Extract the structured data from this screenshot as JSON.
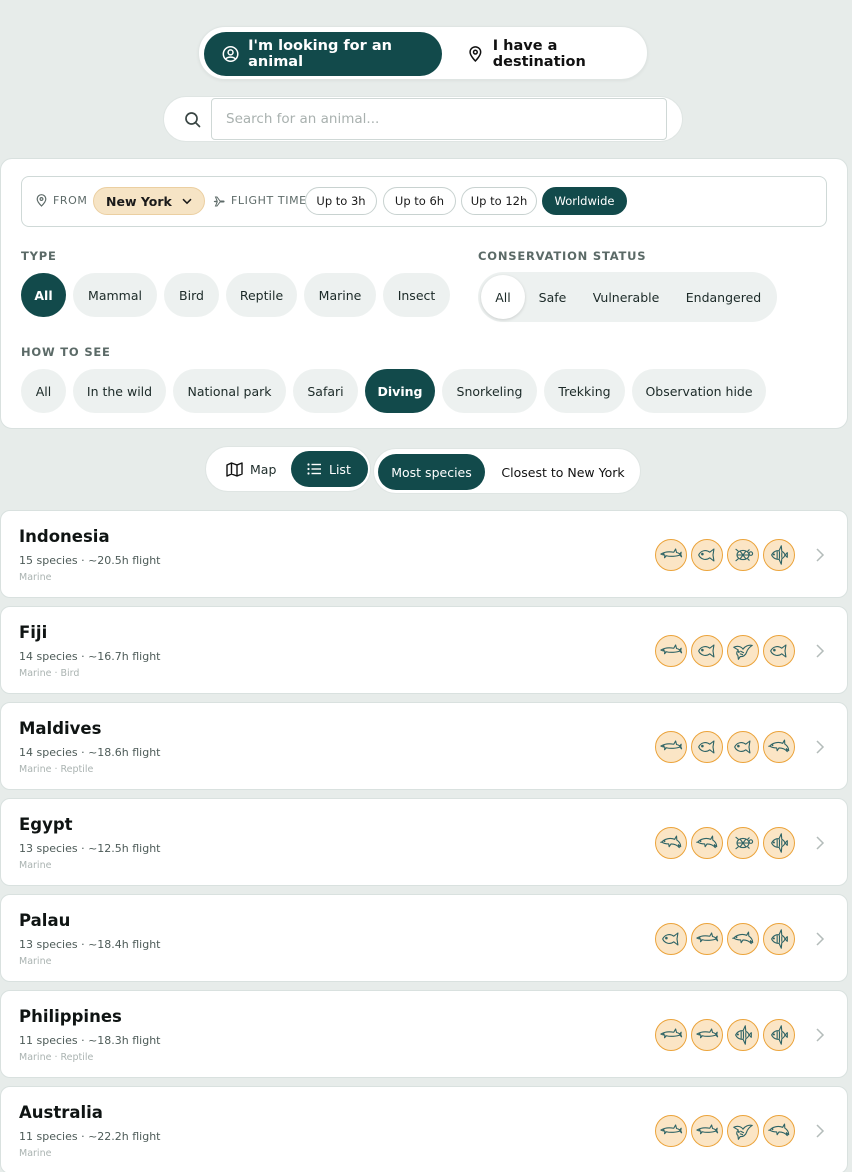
{
  "mode_toggle": {
    "active_label": "I'm looking for an animal",
    "inactive_label": "I have a destination"
  },
  "search": {
    "placeholder": "Search for an animal..."
  },
  "filters": {
    "from_label": "FROM",
    "from_city": "New York",
    "flight_time_label": "FLIGHT TIME",
    "flight_options": [
      {
        "label": "Up to 3h",
        "active": false
      },
      {
        "label": "Up to 6h",
        "active": false
      },
      {
        "label": "Up to 12h",
        "active": false
      },
      {
        "label": "Worldwide",
        "active": true
      }
    ],
    "type_label": "TYPE",
    "types": [
      {
        "label": "All",
        "active": true
      },
      {
        "label": "Mammal",
        "active": false
      },
      {
        "label": "Bird",
        "active": false
      },
      {
        "label": "Reptile",
        "active": false
      },
      {
        "label": "Marine",
        "active": false
      },
      {
        "label": "Insect",
        "active": false
      }
    ],
    "conservation_label": "CONSERVATION STATUS",
    "conservation": [
      {
        "label": "All",
        "active": true
      },
      {
        "label": "Safe",
        "active": false
      },
      {
        "label": "Vulnerable",
        "active": false
      },
      {
        "label": "Endangered",
        "active": false
      }
    ],
    "how_label": "HOW TO SEE",
    "how": [
      {
        "label": "All",
        "active": false
      },
      {
        "label": "In the wild",
        "active": false
      },
      {
        "label": "National park",
        "active": false
      },
      {
        "label": "Safari",
        "active": false
      },
      {
        "label": "Diving",
        "active": true
      },
      {
        "label": "Snorkeling",
        "active": false
      },
      {
        "label": "Trekking",
        "active": false
      },
      {
        "label": "Observation hide",
        "active": false
      }
    ]
  },
  "view": {
    "map_label": "Map",
    "list_label": "List",
    "active": "list"
  },
  "sort": {
    "most_label": "Most species",
    "closest_label": "Closest to New York",
    "active": "most"
  },
  "destinations": [
    {
      "name": "Indonesia",
      "meta": "15 species · ~20.5h flight",
      "tags": "Marine",
      "icons": [
        "shark-icon",
        "fish-icon",
        "turtle-icon",
        "angelfish-icon"
      ]
    },
    {
      "name": "Fiji",
      "meta": "14 species · ~16.7h flight",
      "tags": "Marine · Bird",
      "icons": [
        "shark-icon",
        "fish-icon",
        "bird-icon",
        "fish-icon"
      ]
    },
    {
      "name": "Maldives",
      "meta": "14 species · ~18.6h flight",
      "tags": "Marine · Reptile",
      "icons": [
        "shark-icon",
        "fish-icon",
        "fish-icon",
        "dolphin-icon"
      ]
    },
    {
      "name": "Egypt",
      "meta": "13 species · ~12.5h flight",
      "tags": "Marine",
      "icons": [
        "dolphin-icon",
        "dolphin-icon",
        "turtle-icon",
        "angelfish-icon"
      ]
    },
    {
      "name": "Palau",
      "meta": "13 species · ~18.4h flight",
      "tags": "Marine",
      "icons": [
        "fish-icon",
        "shark-icon",
        "dolphin-icon",
        "angelfish-icon"
      ]
    },
    {
      "name": "Philippines",
      "meta": "11 species · ~18.3h flight",
      "tags": "Marine · Reptile",
      "icons": [
        "shark-icon",
        "shark-icon",
        "angelfish-icon",
        "angelfish-icon"
      ]
    },
    {
      "name": "Australia",
      "meta": "11 species · ~22.2h flight",
      "tags": "Marine",
      "icons": [
        "shark-icon",
        "shark-icon",
        "bird-icon",
        "dolphin-icon"
      ]
    }
  ],
  "colors": {
    "primary": "#124a4b",
    "accent": "#eba33a",
    "badge_bg": "#fbe5c5",
    "page_bg": "#e7ecea"
  }
}
